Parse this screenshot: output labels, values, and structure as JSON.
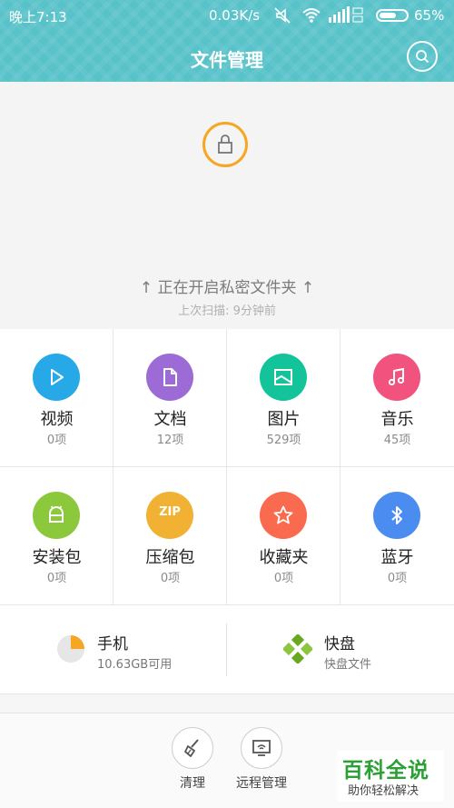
{
  "status_bar": {
    "time": "晚上7:13",
    "speed": "0.03K/s",
    "battery_pct": "65%",
    "battery_level": 0.65
  },
  "header": {
    "title": "文件管理"
  },
  "hero": {
    "text": "↑ 正在开启私密文件夹 ↑",
    "sub": "上次扫描: 9分钟前"
  },
  "categories": [
    {
      "label": "视频",
      "count": "0项",
      "color": "#27a9e8",
      "icon": "play-icon"
    },
    {
      "label": "文档",
      "count": "12项",
      "color": "#9c6bd6",
      "icon": "document-icon"
    },
    {
      "label": "图片",
      "count": "529项",
      "color": "#13c39a",
      "icon": "image-icon"
    },
    {
      "label": "音乐",
      "count": "45项",
      "color": "#f2527e",
      "icon": "music-icon"
    },
    {
      "label": "安装包",
      "count": "0项",
      "color": "#8cc83c",
      "icon": "android-icon"
    },
    {
      "label": "压缩包",
      "count": "0项",
      "color": "#f1b233",
      "icon": "zip-icon",
      "badge": "ZIP"
    },
    {
      "label": "收藏夹",
      "count": "0项",
      "color": "#fa6a4f",
      "icon": "star-icon"
    },
    {
      "label": "蓝牙",
      "count": "0项",
      "color": "#4b8cf0",
      "icon": "bluetooth-icon"
    }
  ],
  "storage": {
    "phone": {
      "title": "手机",
      "sub": "10.63GB可用",
      "used_fraction": 0.25
    },
    "kuaipan": {
      "title": "快盘",
      "sub": "快盘文件"
    }
  },
  "bottom": {
    "clean_label": "清理",
    "remote_label": "远程管理"
  },
  "watermark": {
    "main": "百科全说",
    "sub": "助你轻松解决"
  },
  "colors": {
    "header": "#58c2c9",
    "lock_ring": "#f5a623",
    "watermark_green": "#2aa035"
  }
}
